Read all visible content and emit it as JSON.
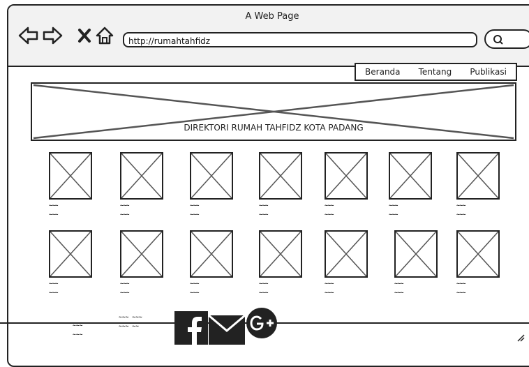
{
  "window": {
    "title": "A Web Page"
  },
  "toolbar": {
    "back_icon": "back-arrow-icon",
    "forward_icon": "forward-arrow-icon",
    "stop_icon": "close-icon",
    "home_icon": "home-icon",
    "url": "http://rumahtahfidz",
    "search_icon": "search-icon"
  },
  "menu": {
    "items": [
      "Beranda",
      "Tentang",
      "Publikasi"
    ]
  },
  "banner": {
    "text": "DIREKTORI RUMAH TAHFIDZ KOTA PADANG"
  },
  "grid": {
    "caption_line1": "~~~",
    "caption_line2": "~~~"
  },
  "footer": {
    "left_line1": "~~~",
    "left_line2": "~~~",
    "mid_line1": "~~~ ~~~",
    "mid_line2": "~~~ ~~",
    "social_icons": [
      "facebook-icon",
      "mail-icon",
      "google-plus-icon"
    ]
  },
  "colors": {
    "stroke": "#222222",
    "chrome_bg": "#f2f2f2",
    "page_bg": "#ffffff"
  }
}
